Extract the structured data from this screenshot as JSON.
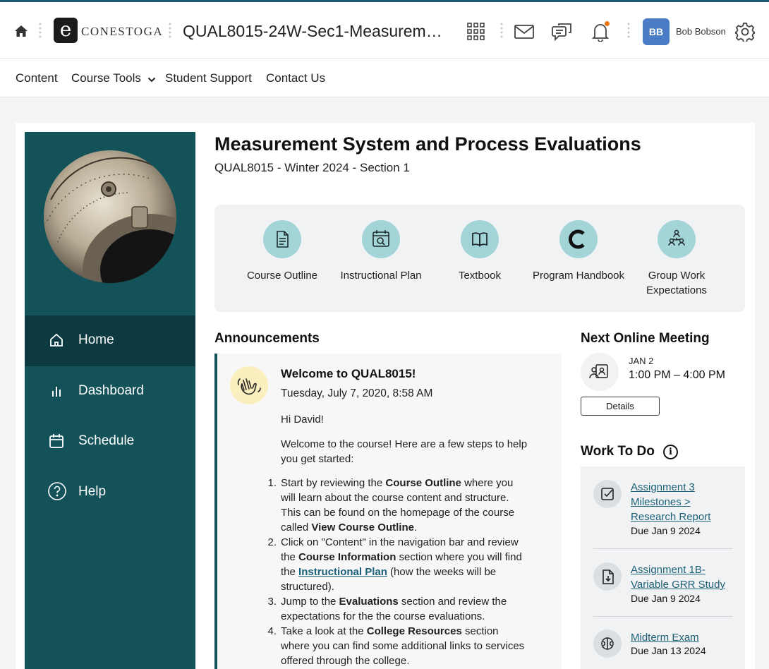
{
  "header": {
    "logo_letter": "e",
    "logo_text": "CONESTOGA",
    "course_title": "QUAL8015-24W-Sec1-Measurem…",
    "user_initials": "BB",
    "user_name": "Bob Bobson"
  },
  "nav": {
    "content": "Content",
    "course_tools": "Course Tools",
    "student_support": "Student Support",
    "contact_us": "Contact Us"
  },
  "sidebar": {
    "items": [
      {
        "label": "Home"
      },
      {
        "label": "Dashboard"
      },
      {
        "label": "Schedule"
      },
      {
        "label": "Help"
      }
    ]
  },
  "page": {
    "title": "Measurement System and Process Evaluations",
    "subtitle": "QUAL8015 - Winter 2024 - Section 1"
  },
  "quick_links": [
    {
      "label": "Course Outline",
      "icon": "document-icon"
    },
    {
      "label": "Instructional Plan",
      "icon": "calendar-search-icon"
    },
    {
      "label": "Textbook",
      "icon": "book-icon"
    },
    {
      "label": "Program Handbook",
      "icon": "conestoga-c-icon"
    },
    {
      "label": "Group Work Expectations",
      "icon": "group-icon"
    }
  ],
  "announcements": {
    "heading": "Announcements",
    "title": "Welcome to QUAL8015!",
    "date": "Tuesday, July 7, 2020, 8:58 AM",
    "greeting": "Hi David!",
    "intro": "Welcome to the course!  Here are a few steps to help you get started:",
    "steps": [
      {
        "num": "1.",
        "a": "Start by reviewing the ",
        "b": "Course Outline",
        "c": " where you will learn about the course content and structure. This can be found on the homepage of the course called ",
        "d": "View Course Outline",
        "e": "."
      },
      {
        "num": "2.",
        "a": "Click on \"Content\" in the navigation bar and review the ",
        "b": "Course Information",
        "c": " section where you will find the ",
        "link": "Instructional Plan",
        "e": " (how the weeks will be structured)."
      },
      {
        "num": "3.",
        "a": "Jump to the ",
        "b": "Evaluations",
        "c": " section and review the expectations for the the course evaluations."
      },
      {
        "num": "4.",
        "a": "Take a look at the ",
        "b": "College Resources",
        "c": " section where you can find some additional links to services offered through the college."
      }
    ]
  },
  "meeting": {
    "heading": "Next Online Meeting",
    "date": "JAN 2",
    "time": "1:00 PM – 4:00 PM",
    "details": "Details"
  },
  "work_to_do": {
    "heading": "Work To Do",
    "info_glyph": "i",
    "items": [
      {
        "line1": "Assignment 3",
        "line2": "Milestones >",
        "line3": "Research Report",
        "due": "Due Jan 9 2024",
        "icon": "checkbox-icon"
      },
      {
        "line1": "Assignment 1B-",
        "line2": "Variable GRR Study",
        "due": "Due Jan 9 2024",
        "icon": "file-download-icon"
      },
      {
        "line1": "Midterm Exam",
        "due": "Due Jan 13 2024",
        "icon": "brain-icon"
      }
    ]
  },
  "colors": {
    "sidebar": "#14525a",
    "sidebar_active": "#0d3a40",
    "quicklink_circle": "#a3d4d8",
    "link": "#1d6178",
    "avatar": "#4a7dc6",
    "notification": "#e87511"
  }
}
